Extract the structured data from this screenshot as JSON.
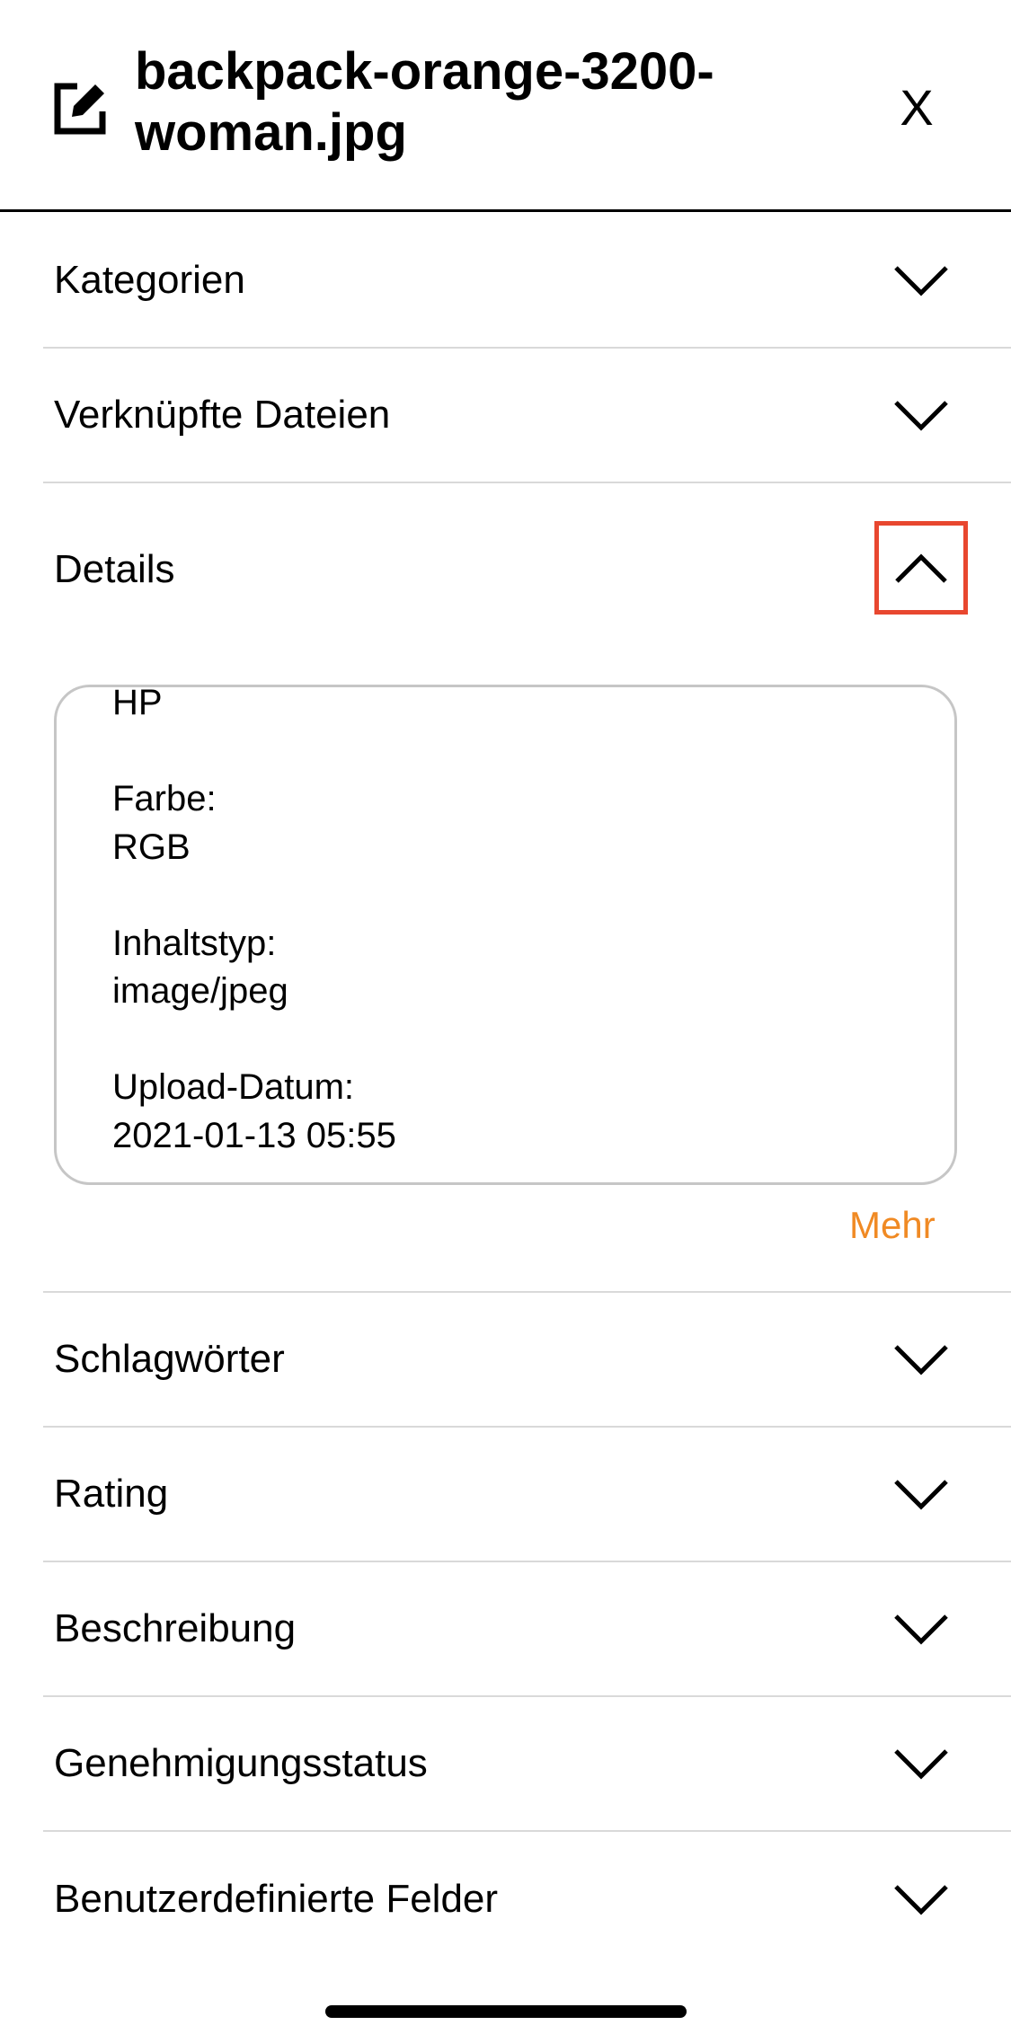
{
  "header": {
    "title": "backpack-orange-3200-woman.jpg",
    "close_label": "X"
  },
  "sections_top": [
    {
      "label": "Kategorien"
    },
    {
      "label": "Verknüpfte Dateien"
    }
  ],
  "details": {
    "label": "Details",
    "content": "HP\n\nFarbe:\nRGB\n\nInhaltstyp:\nimage/jpeg\n\nUpload-Datum:\n2021-01-13 05:55",
    "more_label": "Mehr",
    "more_color": "#f08a24",
    "highlight_color": "#e8472f"
  },
  "sections_bottom": [
    {
      "label": "Schlagwörter"
    },
    {
      "label": "Rating"
    },
    {
      "label": "Beschreibung"
    },
    {
      "label": "Genehmigungsstatus"
    },
    {
      "label": "Benutzerdefinierte Felder"
    }
  ],
  "icons": {
    "edit": "edit-icon",
    "expand": "chevron-down-icon",
    "collapse": "chevron-up-icon"
  }
}
